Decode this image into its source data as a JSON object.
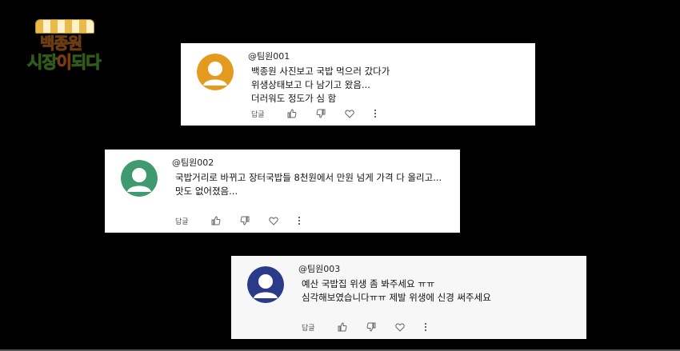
{
  "logo": {
    "line1": "백종원",
    "line2_a": "시장",
    "line2_b": "이",
    "line2_c": "되다"
  },
  "comments": [
    {
      "handle": "@팀원001",
      "avatar_color": "#e39a1f",
      "lines": [
        "백종원 사진보고 국밥 먹으러 갔다가",
        "위생상태보고 다 남기고 왔음...",
        "더러워도 정도가 심 함"
      ],
      "reply_label": "답글"
    },
    {
      "handle": "@팀원002",
      "avatar_color": "#3f9a6f",
      "lines": [
        "국밥거리로 바뀌고 장터국밥들 8천원에서 만원 넘게 가격 다 올리고...",
        "맛도 없어졌음..."
      ],
      "reply_label": "답글"
    },
    {
      "handle": "@팀원003",
      "avatar_color": "#2c3a8a",
      "lines": [
        "예산 국밥집 위생 좀 봐주세요 ㅠㅠ",
        "심각해보였습니다ㅠㅠ 제발 위생에 신경 써주세요"
      ],
      "reply_label": "답글"
    }
  ],
  "icons": {
    "like": "thumbs-up-icon",
    "dislike": "thumbs-down-icon",
    "heart": "heart-icon",
    "more": "more-vertical-icon"
  }
}
